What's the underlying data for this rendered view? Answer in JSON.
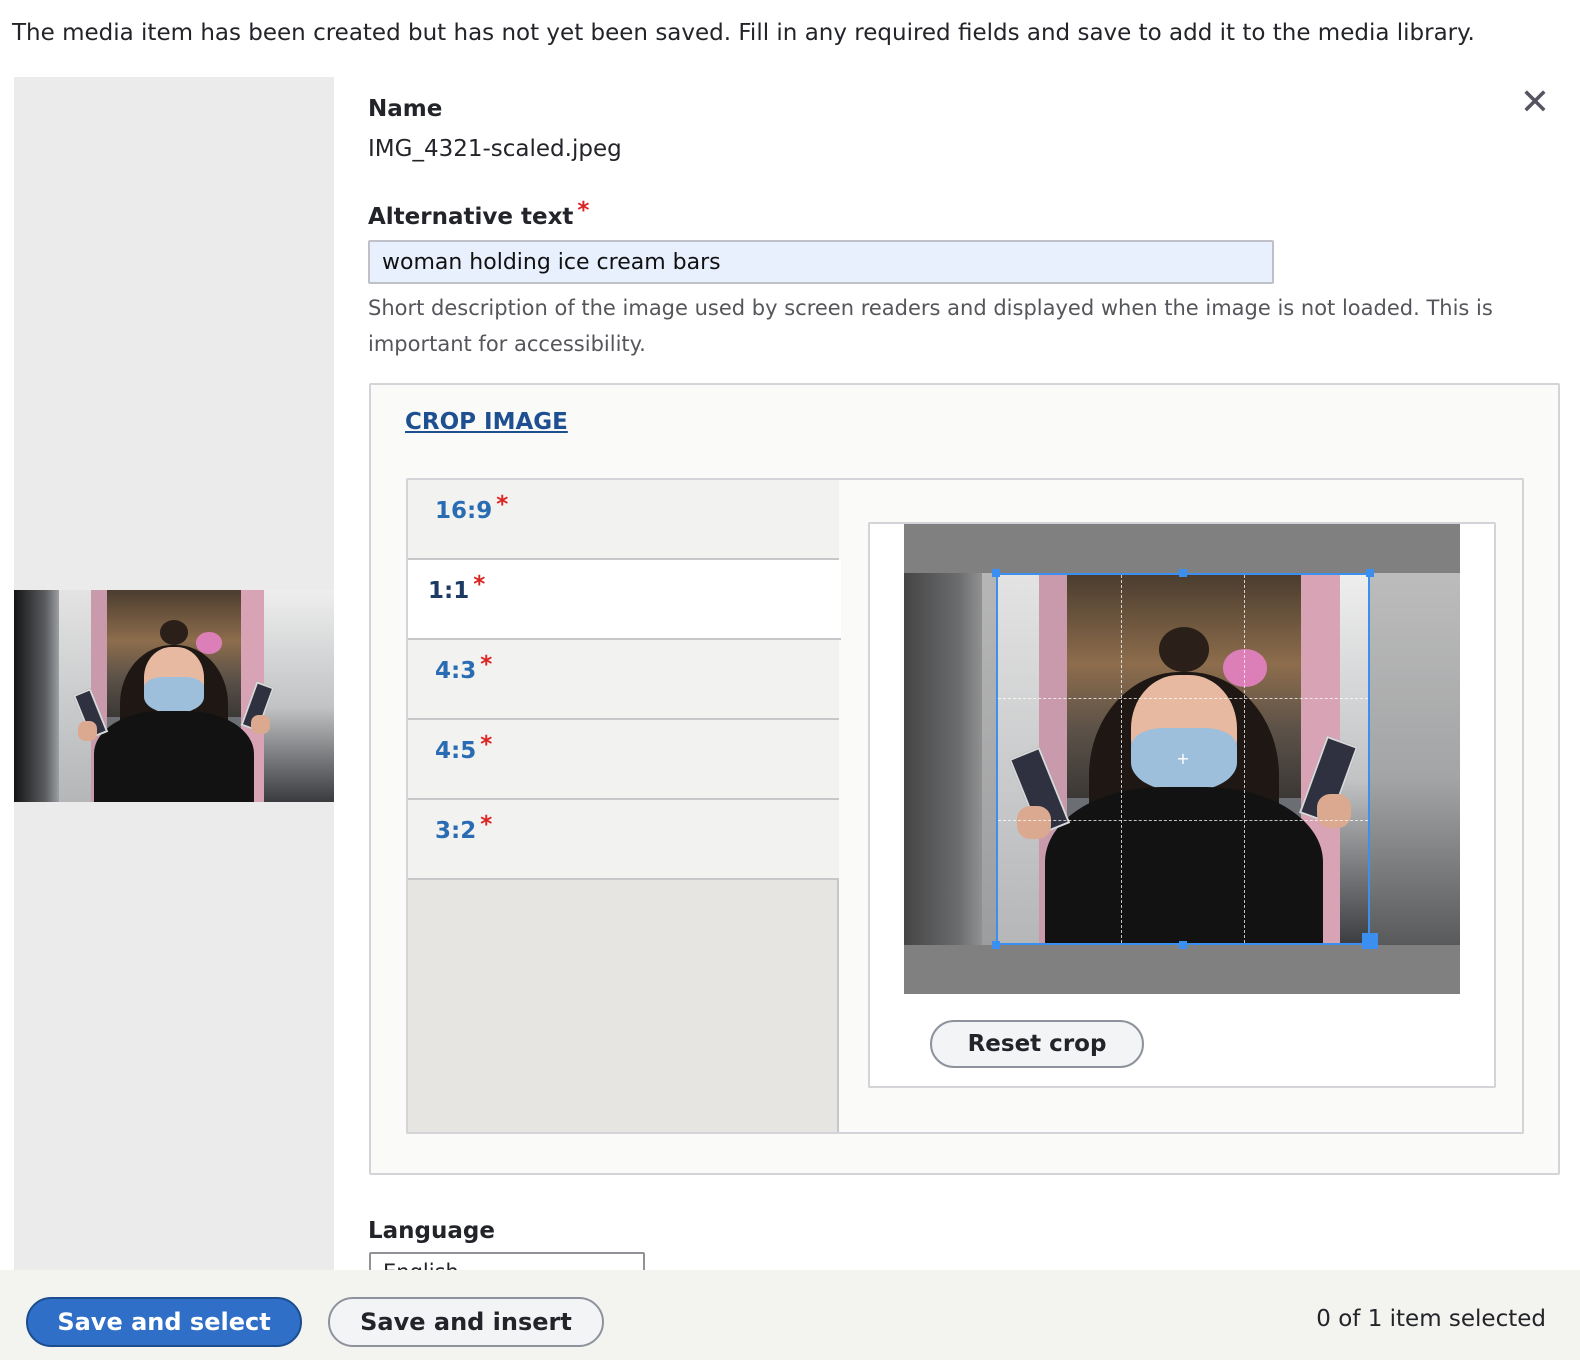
{
  "notice": "The media item has been created but has not yet been saved. Fill in any required fields and save to add it to the media library.",
  "close_icon": "close-icon",
  "name_field": {
    "label": "Name",
    "value": "IMG_4321-scaled.jpeg"
  },
  "alt_field": {
    "label": "Alternative text",
    "required_mark": "*",
    "value": "woman holding ice cream bars",
    "description": "Short description of the image used by screen readers and displayed when the image is not loaded. This is important for accessibility."
  },
  "crop": {
    "legend": "CROP IMAGE",
    "tabs": [
      {
        "label": "16:9",
        "required_mark": "*",
        "active": false
      },
      {
        "label": "1:1",
        "required_mark": "*",
        "active": true
      },
      {
        "label": "4:3",
        "required_mark": "*",
        "active": false
      },
      {
        "label": "4:5",
        "required_mark": "*",
        "active": false
      },
      {
        "label": "3:2",
        "required_mark": "*",
        "active": false
      }
    ],
    "reset_label": "Reset crop",
    "crop_box_color": "#3b8ff0"
  },
  "language_field": {
    "label": "Language",
    "value": "English"
  },
  "footer": {
    "save_select_label": "Save and select",
    "save_insert_label": "Save and insert",
    "selected_count": "0 of 1 item selected"
  },
  "colors": {
    "accent": "#2f6fc7",
    "required": "#dc2323",
    "tab_link": "#2a6cb3"
  }
}
